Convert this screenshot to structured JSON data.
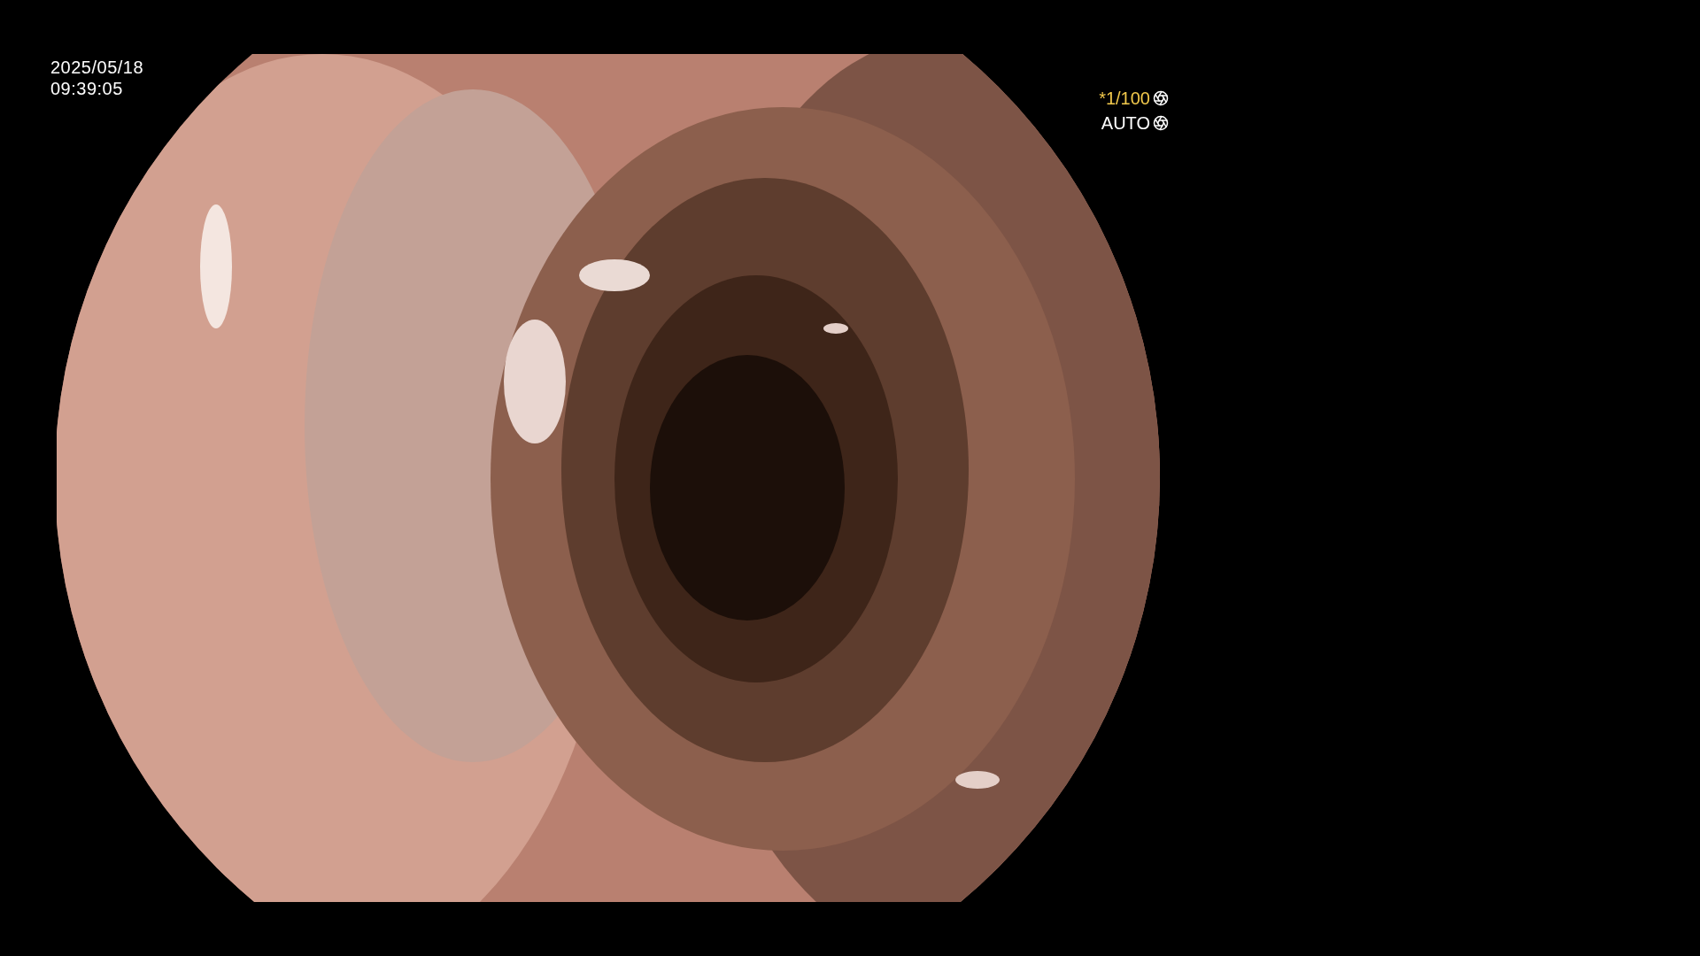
{
  "timestamp": {
    "date": "2025/05/18",
    "time": "09:39:05"
  },
  "camera": {
    "shutter": "*1/100",
    "mode": "AUTO"
  }
}
